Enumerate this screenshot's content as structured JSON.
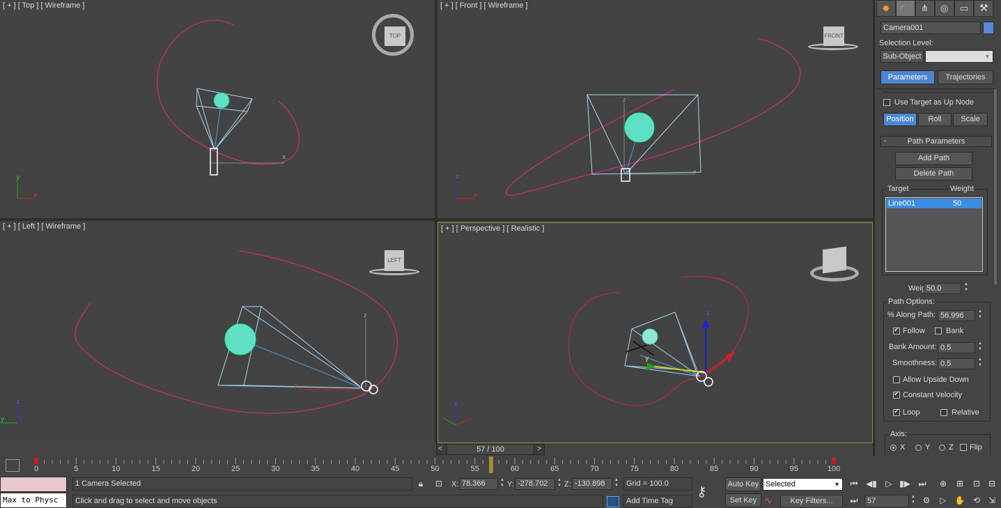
{
  "viewports": {
    "top": {
      "label": "[ + ] [ Top ] [ Wireframe ]",
      "cube": "TOP"
    },
    "front": {
      "label": "[ + ] [ Front ] [ Wireframe ]",
      "cube": "FRONT"
    },
    "left": {
      "label": "[ + ] [ Left ] [ Wireframe ]",
      "cube": "LEFT"
    },
    "perspective": {
      "label": "[ + ] [ Perspective ] [ Realistic ]"
    }
  },
  "command_panel": {
    "object_name": "Camera001",
    "object_color": "#5b87d8",
    "selection_level_label": "Selection Level:",
    "sub_object_label": "Sub-Object",
    "tabs": {
      "parameters": "Parameters",
      "trajectories": "Trajectories"
    },
    "use_target_up_node": "Use Target as Up Node",
    "mode_buttons": {
      "position": "Position",
      "roll": "Roll",
      "scale": "Scale"
    },
    "rollout_toggle": "-",
    "rollout_title": "Path Parameters",
    "add_path": "Add Path",
    "delete_path": "Delete Path",
    "list_headers": {
      "target": "Target",
      "weight": "Weight"
    },
    "list_rows": [
      {
        "target": "Line001",
        "weight": "50"
      }
    ],
    "weight_label": "Weight",
    "weight_value": "50.0",
    "path_options_label": "Path Options:",
    "along_path_label": "% Along Path:",
    "along_path_value": "56.996",
    "follow_label": "Follow",
    "bank_label": "Bank",
    "bank_amount_label": "Bank Amount:",
    "bank_amount_value": "0.5",
    "smoothness_label": "Smoothness:",
    "smoothness_value": "0.5",
    "allow_upside_down": "Allow Upside Down",
    "constant_velocity": "Constant Velocity",
    "loop_label": "Loop",
    "relative_label": "Relative",
    "axis_label": "Axis:",
    "axis_x": "X",
    "axis_y": "Y",
    "axis_z": "Z",
    "flip_label": "Flip",
    "states": {
      "follow": true,
      "bank": false,
      "allow_upside_down": false,
      "constant_velocity": true,
      "loop": true,
      "relative": false,
      "use_target_up": false,
      "flip": false,
      "axis": "X"
    }
  },
  "timeline": {
    "slider_label": "57 / 100",
    "prev": "<",
    "next": ">",
    "ticks": [
      "0",
      "5",
      "10",
      "15",
      "20",
      "25",
      "30",
      "35",
      "40",
      "45",
      "50",
      "55",
      "60",
      "65",
      "70",
      "75",
      "80",
      "85",
      "90",
      "95",
      "100"
    ],
    "current_frame": 57
  },
  "status": {
    "script_listener": "Max to Physc",
    "selection_status": "1 Camera Selected",
    "prompt": "Click and drag to select and move objects",
    "x_label": "X:",
    "x_value": "78.366",
    "y_label": "Y:",
    "y_value": "-278.702",
    "z_label": "Z:",
    "z_value": "-130.898",
    "grid": "Grid = 100.0",
    "add_time_tag": "Add Time Tag",
    "auto_key": "Auto Key",
    "set_key": "Set Key",
    "selected_dropdown": "Selected",
    "key_filters": "Key Filters...",
    "frame_value": "57"
  }
}
